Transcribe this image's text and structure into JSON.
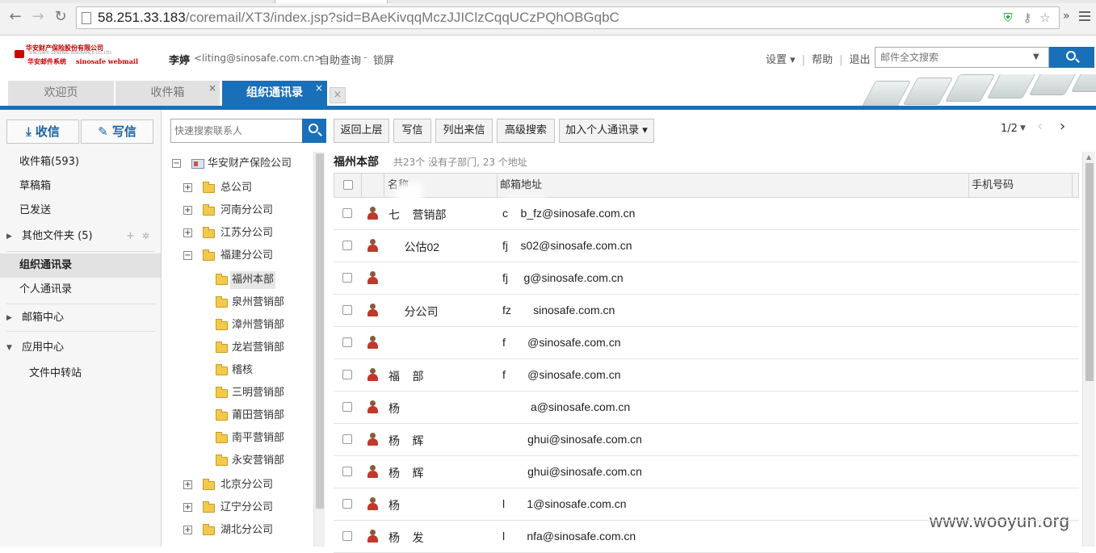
{
  "browser": {
    "url_main": "58.251.33.183",
    "url_rest": "/coremail/XT3/index.jsp?sid=BAeKivqqMczJJIClzCqqUCzPQhOBGqbC",
    "more": "»"
  },
  "logo": {
    "line1": "华安财产保险股份有限公司",
    "line1_en": "SINOSAFE GENERAL INSURANCE CO.,LTD",
    "line2_cn": "华安邮件系统",
    "line2_en": "sinosafe webmail"
  },
  "user": {
    "name": "李婷",
    "email": "<liting@sinosafe.com.cn>",
    "self_query": "自助查询",
    "sep": "-",
    "lock": "锁屏"
  },
  "header_links": {
    "settings": "设置 ▾",
    "help": "帮助",
    "logout": "退出",
    "pipe": "|"
  },
  "search": {
    "placeholder": "邮件全文搜索"
  },
  "tabs": [
    {
      "label": "欢迎页"
    },
    {
      "label": "收件箱",
      "close": "×"
    },
    {
      "label": "组织通讯录",
      "close": "×"
    }
  ],
  "tab_extra": "×",
  "left_nav": {
    "receive": "收信",
    "compose": "写信",
    "items": [
      {
        "label": "收件箱(593)"
      },
      {
        "label": "草稿箱"
      },
      {
        "label": "已发送"
      },
      {
        "label": "其他文件夹 (5)",
        "arrow": "▶",
        "add": "+",
        "gear": "✲"
      },
      {
        "label": "组织通讯录"
      },
      {
        "label": "个人通讯录"
      },
      {
        "label": "邮箱中心",
        "arrow": "▶"
      },
      {
        "label": "应用中心",
        "arrow": "▼"
      },
      {
        "label": "文件中转站"
      }
    ]
  },
  "tree": {
    "search_placeholder": "快速搜索联系人",
    "root": "华安财产保险公司",
    "nodes": [
      {
        "label": "总公司",
        "toggle": "+"
      },
      {
        "label": "河南分公司",
        "toggle": "+"
      },
      {
        "label": "江苏分公司",
        "toggle": "+"
      },
      {
        "label": "福建分公司",
        "toggle": "−"
      },
      {
        "label": "福州本部"
      },
      {
        "label": "泉州营销部"
      },
      {
        "label": "漳州营销部"
      },
      {
        "label": "龙岩营销部"
      },
      {
        "label": "稽核"
      },
      {
        "label": "三明营销部"
      },
      {
        "label": "莆田营销部"
      },
      {
        "label": "南平营销部"
      },
      {
        "label": "永安营销部"
      },
      {
        "label": "北京分公司",
        "toggle": "+"
      },
      {
        "label": "辽宁分公司",
        "toggle": "+"
      },
      {
        "label": "湖北分公司",
        "toggle": "+"
      }
    ],
    "root_toggle": "−"
  },
  "toolbar": {
    "back": "返回上层",
    "write": "写信",
    "list_mails": "列出来信",
    "advanced": "高级搜索",
    "add_personal": "加入个人通讯录 ▾",
    "page": "1/2",
    "page_drop": "▼",
    "prev": "‹",
    "next": "›"
  },
  "department": {
    "title": "福州本部",
    "subtitle": "共23个 没有子部门, 23 个地址"
  },
  "table": {
    "columns": [
      "名称",
      "邮箱地址",
      "手机号码"
    ],
    "rows": [
      {
        "name": "七    营销部",
        "email": "c    b_fz@sinosafe.com.cn"
      },
      {
        "name": "     公估02",
        "email": "fj    s02@sinosafe.com.cn"
      },
      {
        "name": "",
        "email": "fj     g@sinosafe.com.cn"
      },
      {
        "name": "     分公司",
        "email": "fz       sinosafe.com.cn"
      },
      {
        "name": "",
        "email": "f       @sinosafe.com.cn"
      },
      {
        "name": "福    部",
        "email": "f       @sinosafe.com.cn"
      },
      {
        "name": "杨",
        "email": "         a@sinosafe.com.cn"
      },
      {
        "name": "杨    辉",
        "email": "        ghui@sinosafe.com.cn"
      },
      {
        "name": "杨    辉",
        "email": "        ghui@sinosafe.com.cn"
      },
      {
        "name": "杨",
        "email": "l       1@sinosafe.com.cn"
      },
      {
        "name": "杨    发",
        "email": "l       nfa@sinosafe.com.cn"
      }
    ]
  },
  "watermark": "www.wooyun.org",
  "colors": {
    "accent": "#1a6fb9",
    "tab_inactive": "#e1e1e1",
    "nav_bg": "#f6f6f6"
  }
}
